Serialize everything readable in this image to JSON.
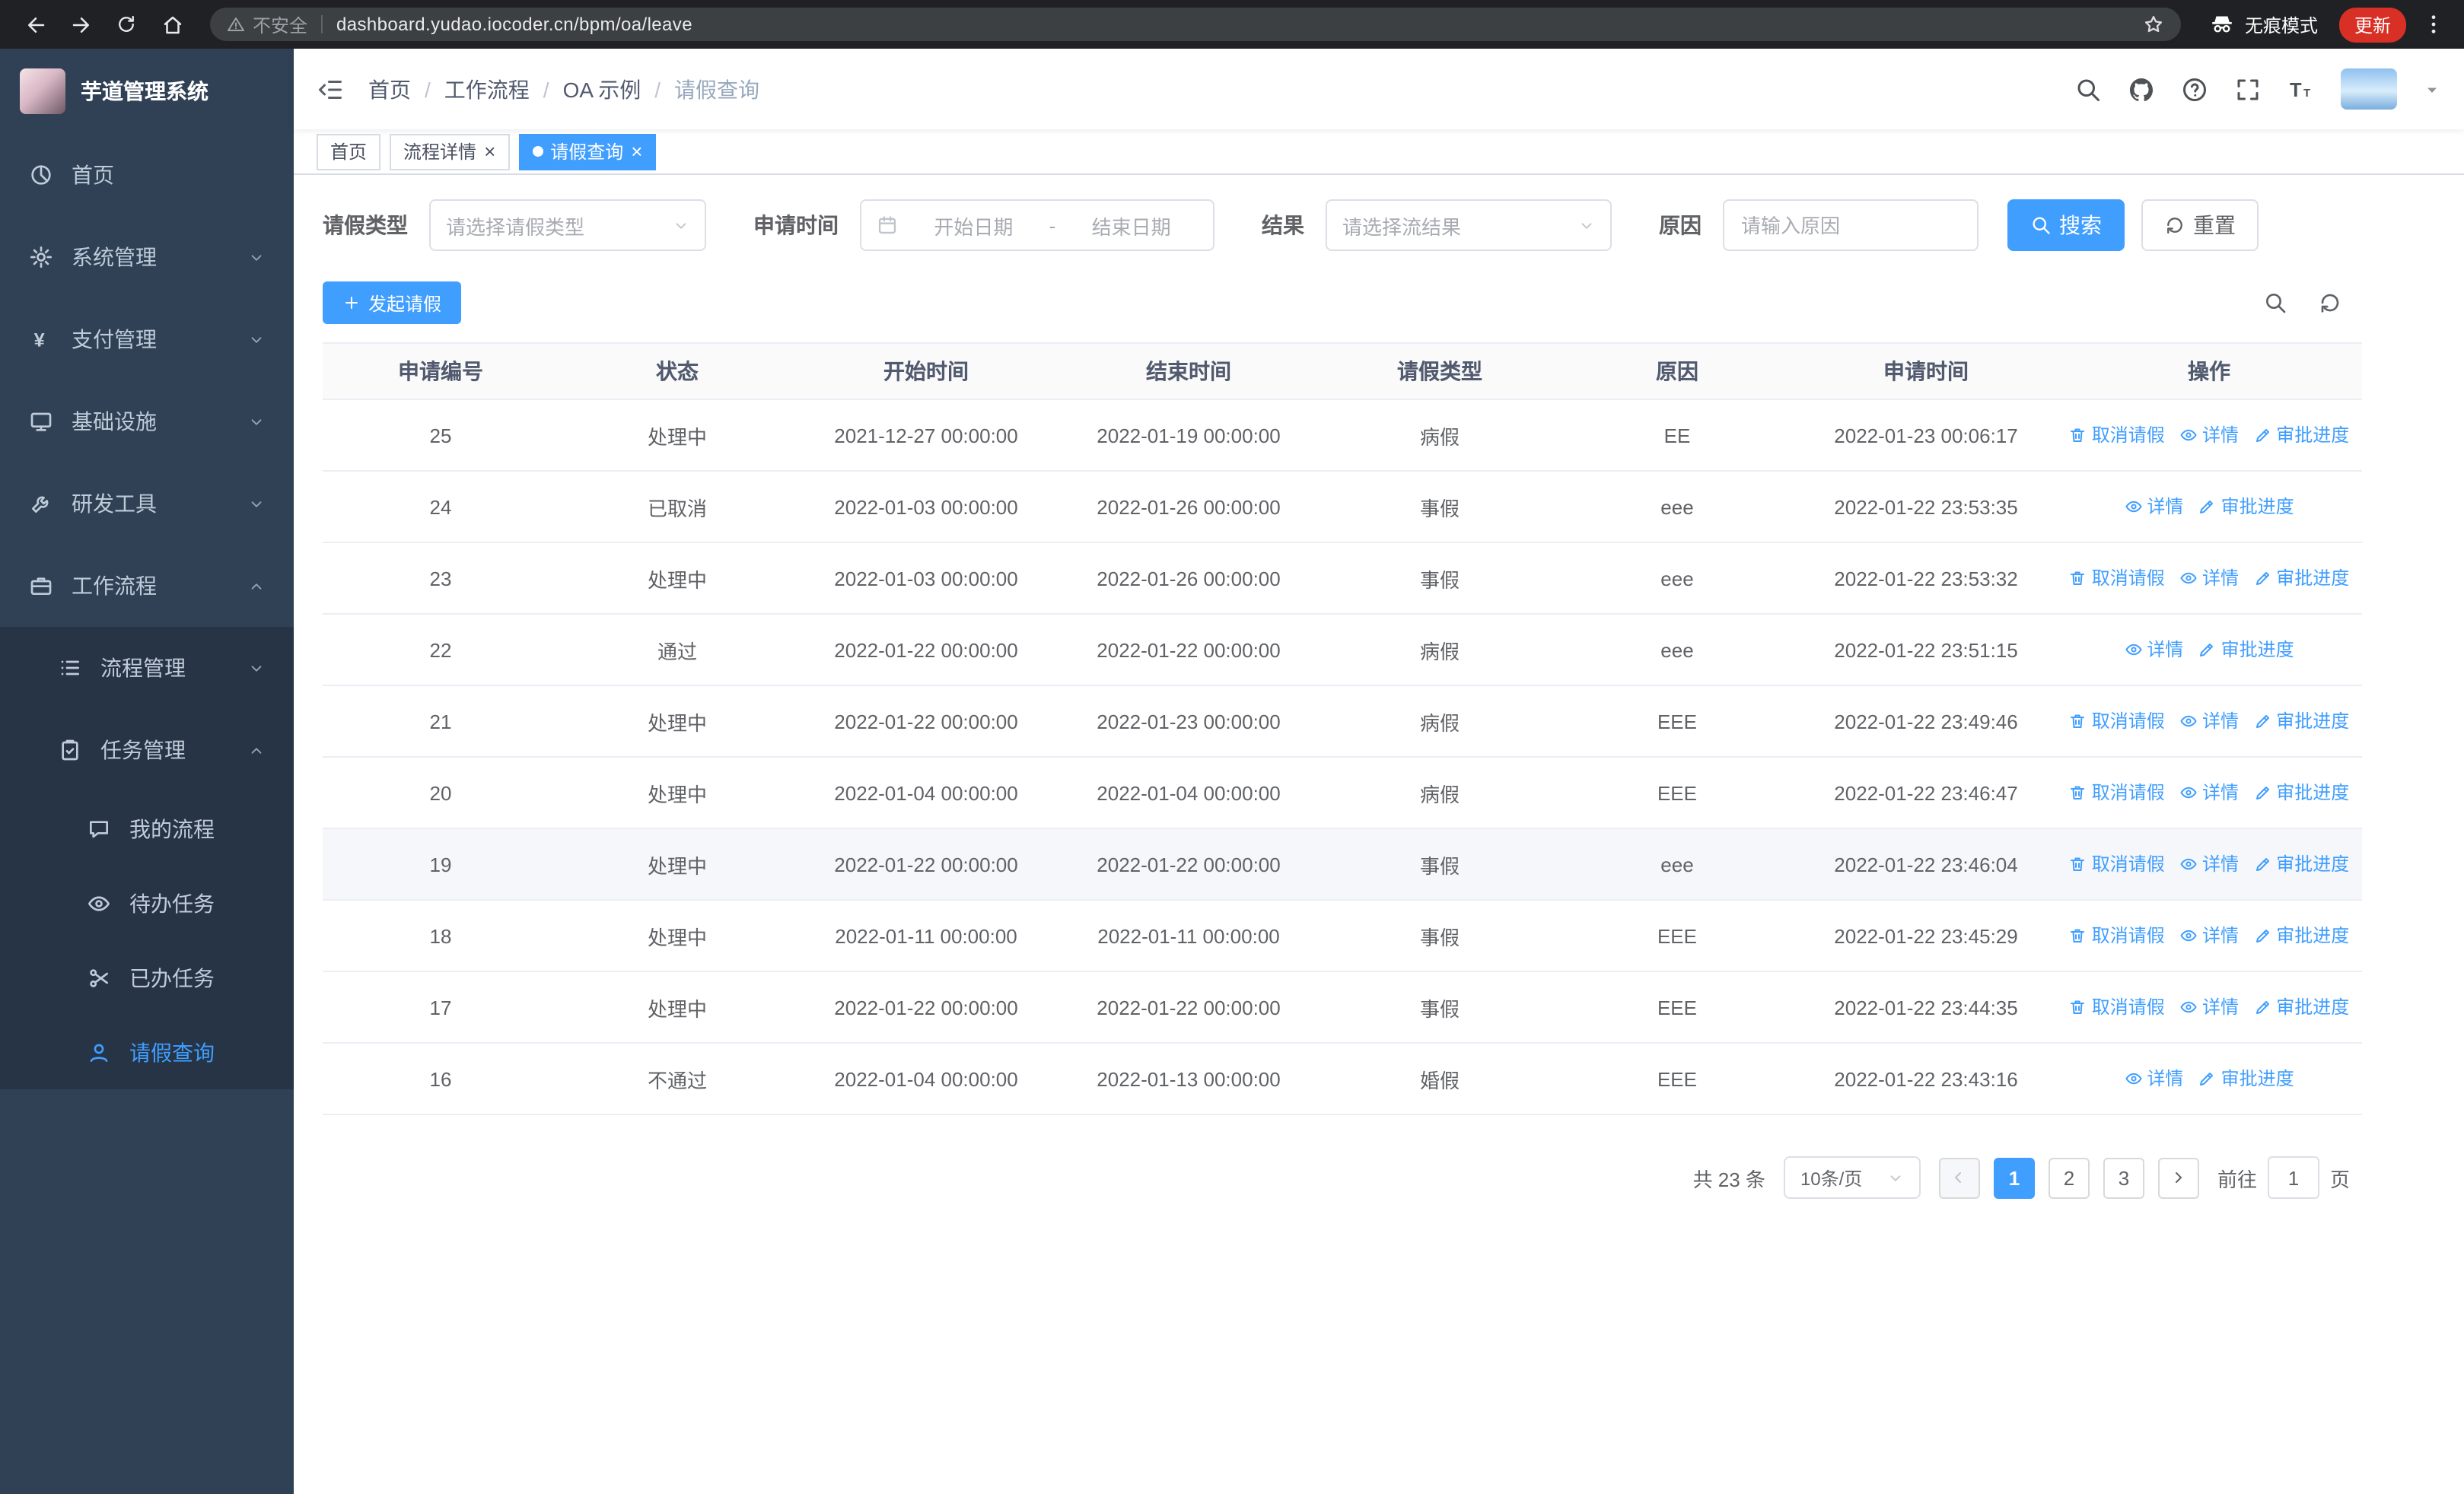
{
  "colors": {
    "accent": "#409eff",
    "sidebar_bg": "#304156",
    "submenu_bg": "#263445",
    "update_badge": "#d93025",
    "table_border": "#ebeef5"
  },
  "icons": {
    "close": "×"
  },
  "browser": {
    "security_warning": "不安全",
    "url": "dashboard.yudao.iocoder.cn/bpm/oa/leave",
    "incognito_label": "无痕模式",
    "update_label": "更新"
  },
  "sidebar": {
    "logo_title": "芋道管理系统",
    "items": [
      {
        "label": "首页"
      },
      {
        "label": "系统管理"
      },
      {
        "label": "支付管理"
      },
      {
        "label": "基础设施"
      },
      {
        "label": "研发工具"
      },
      {
        "label": "工作流程",
        "children": [
          {
            "label": "流程管理"
          },
          {
            "label": "任务管理",
            "children": [
              {
                "label": "我的流程"
              },
              {
                "label": "待办任务"
              },
              {
                "label": "已办任务"
              },
              {
                "label": "请假查询",
                "active": true
              }
            ]
          }
        ]
      }
    ]
  },
  "header": {
    "breadcrumb": [
      "首页",
      "工作流程",
      "OA 示例",
      "请假查询"
    ]
  },
  "tabs": [
    {
      "label": "首页",
      "closable": false,
      "active": false
    },
    {
      "label": "流程详情",
      "closable": true,
      "active": false
    },
    {
      "label": "请假查询",
      "closable": true,
      "active": true
    }
  ],
  "filters": {
    "leave_type_label": "请假类型",
    "leave_type_placeholder": "请选择请假类型",
    "apply_time_label": "申请时间",
    "start_date_placeholder": "开始日期",
    "date_separator": "-",
    "end_date_placeholder": "结束日期",
    "result_label": "结果",
    "result_placeholder": "请选择流结果",
    "reason_label": "原因",
    "reason_placeholder": "请输入原因",
    "search_label": "搜索",
    "reset_label": "重置"
  },
  "toolbar": {
    "create_label": "发起请假"
  },
  "table": {
    "columns": [
      "申请编号",
      "状态",
      "开始时间",
      "结束时间",
      "请假类型",
      "原因",
      "申请时间",
      "操作"
    ],
    "actions": {
      "cancel": "取消请假",
      "detail": "详情",
      "progress": "审批进度"
    },
    "rows": [
      {
        "id": "25",
        "status": "处理中",
        "start": "2021-12-27 00:00:00",
        "end": "2022-01-19 00:00:00",
        "type": "病假",
        "reason": "EE",
        "applied": "2022-01-23 00:06:17",
        "cancellable": true,
        "highlighted": false
      },
      {
        "id": "24",
        "status": "已取消",
        "start": "2022-01-03 00:00:00",
        "end": "2022-01-26 00:00:00",
        "type": "事假",
        "reason": "eee",
        "applied": "2022-01-22 23:53:35",
        "cancellable": false,
        "highlighted": false
      },
      {
        "id": "23",
        "status": "处理中",
        "start": "2022-01-03 00:00:00",
        "end": "2022-01-26 00:00:00",
        "type": "事假",
        "reason": "eee",
        "applied": "2022-01-22 23:53:32",
        "cancellable": true,
        "highlighted": false
      },
      {
        "id": "22",
        "status": "通过",
        "start": "2022-01-22 00:00:00",
        "end": "2022-01-22 00:00:00",
        "type": "病假",
        "reason": "eee",
        "applied": "2022-01-22 23:51:15",
        "cancellable": false,
        "highlighted": false
      },
      {
        "id": "21",
        "status": "处理中",
        "start": "2022-01-22 00:00:00",
        "end": "2022-01-23 00:00:00",
        "type": "病假",
        "reason": "EEE",
        "applied": "2022-01-22 23:49:46",
        "cancellable": true,
        "highlighted": false
      },
      {
        "id": "20",
        "status": "处理中",
        "start": "2022-01-04 00:00:00",
        "end": "2022-01-04 00:00:00",
        "type": "病假",
        "reason": "EEE",
        "applied": "2022-01-22 23:46:47",
        "cancellable": true,
        "highlighted": false
      },
      {
        "id": "19",
        "status": "处理中",
        "start": "2022-01-22 00:00:00",
        "end": "2022-01-22 00:00:00",
        "type": "事假",
        "reason": "eee",
        "applied": "2022-01-22 23:46:04",
        "cancellable": true,
        "highlighted": true
      },
      {
        "id": "18",
        "status": "处理中",
        "start": "2022-01-11 00:00:00",
        "end": "2022-01-11 00:00:00",
        "type": "事假",
        "reason": "EEE",
        "applied": "2022-01-22 23:45:29",
        "cancellable": true,
        "highlighted": false
      },
      {
        "id": "17",
        "status": "处理中",
        "start": "2022-01-22 00:00:00",
        "end": "2022-01-22 00:00:00",
        "type": "事假",
        "reason": "EEE",
        "applied": "2022-01-22 23:44:35",
        "cancellable": true,
        "highlighted": false
      },
      {
        "id": "16",
        "status": "不通过",
        "start": "2022-01-04 00:00:00",
        "end": "2022-01-13 00:00:00",
        "type": "婚假",
        "reason": "EEE",
        "applied": "2022-01-22 23:43:16",
        "cancellable": false,
        "highlighted": false
      }
    ]
  },
  "pagination": {
    "total": "共 23 条",
    "page_size": "10条/页",
    "pages": [
      "1",
      "2",
      "3"
    ],
    "active_page": "1",
    "goto_label": "前往",
    "goto_value": "1",
    "goto_suffix": "页"
  }
}
